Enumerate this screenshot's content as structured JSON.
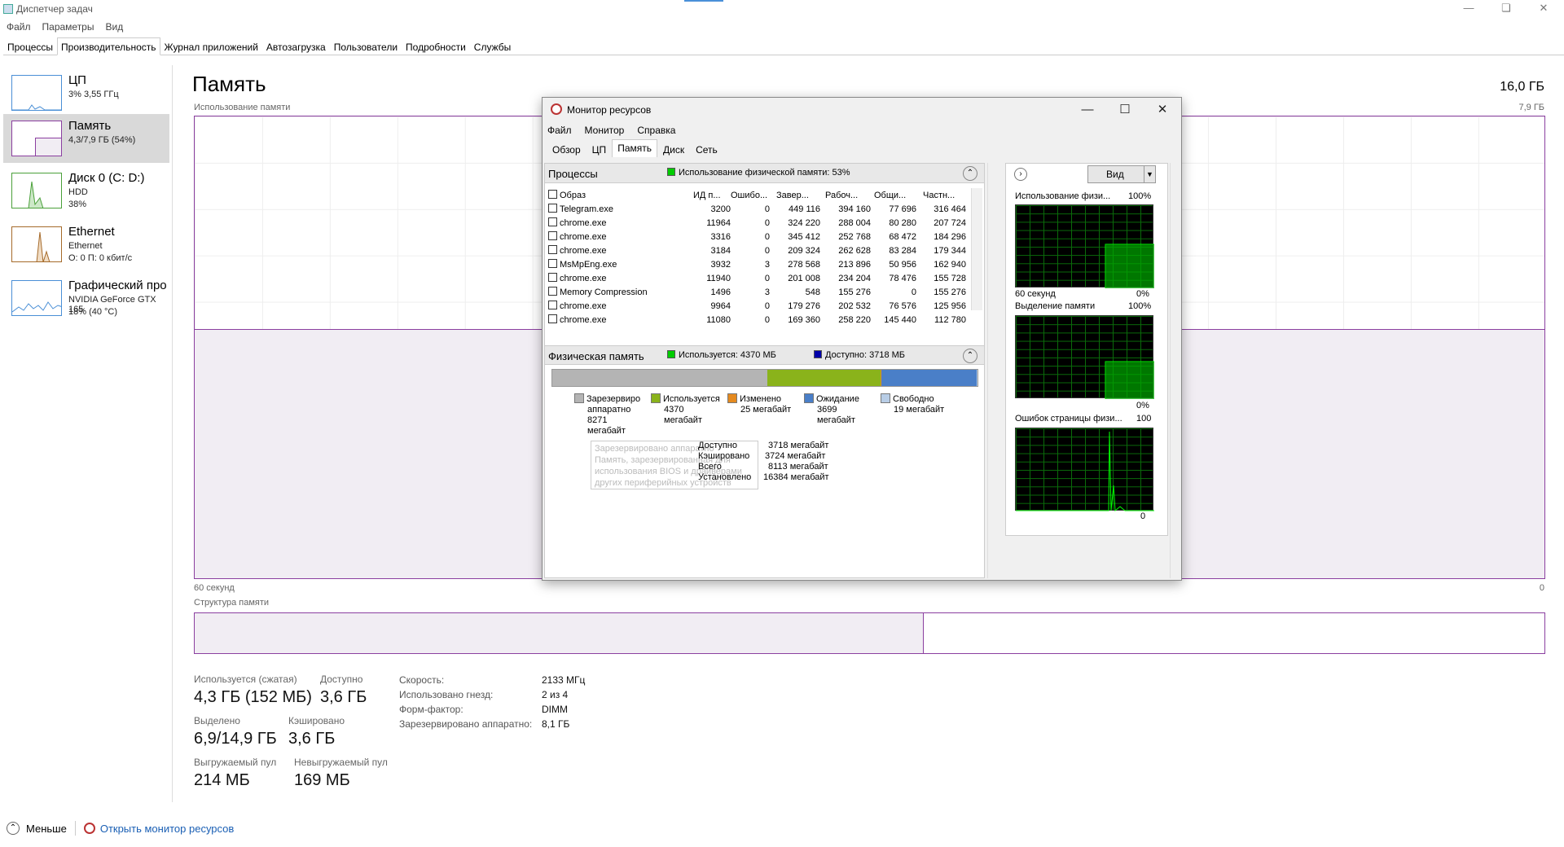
{
  "window": {
    "title": "Диспетчер задач"
  },
  "menu": [
    "Файл",
    "Параметры",
    "Вид"
  ],
  "tabs": [
    "Процессы",
    "Производительность",
    "Журнал приложений",
    "Автозагрузка",
    "Пользователи",
    "Подробности",
    "Службы"
  ],
  "sidebar": [
    {
      "name": "ЦП",
      "l2": "3% 3,55 ГГц",
      "l3": ""
    },
    {
      "name": "Память",
      "l2": "4,3/7,9 ГБ (54%)",
      "l3": ""
    },
    {
      "name": "Диск 0 (C: D:)",
      "l2": "HDD",
      "l3": "38%"
    },
    {
      "name": "Ethernet",
      "l2": "Ethernet",
      "l3": "О: 0 П: 0 кбит/с"
    },
    {
      "name": "Графический про",
      "l2": "NVIDIA GeForce GTX 165",
      "l3": "18% (40 °C)"
    }
  ],
  "main": {
    "title": "Память",
    "total": "16,0 ГБ",
    "usage_label": "Использование памяти",
    "usage_max": "7,9 ГБ",
    "time_label": "60 секунд",
    "time_zero": "0",
    "struct_label": "Структура памяти",
    "graph_fill_fraction": 0.54
  },
  "stats": [
    {
      "label": "Используется (сжатая)",
      "value": "4,3 ГБ (152 МБ)"
    },
    {
      "label": "Доступно",
      "value": "3,6 ГБ"
    },
    {
      "label": "Выделено",
      "value": "6,9/14,9 ГБ"
    },
    {
      "label": "Кэшировано",
      "value": "3,6 ГБ"
    },
    {
      "label": "Выгружаемый пул",
      "value": "214 МБ"
    },
    {
      "label": "Невыгружаемый пул",
      "value": "169 МБ"
    }
  ],
  "kv": [
    {
      "k": "Скорость:",
      "v": "2133 МГц"
    },
    {
      "k": "Использовано гнезд:",
      "v": "2 из 4"
    },
    {
      "k": "Форм-фактор:",
      "v": "DIMM"
    },
    {
      "k": "Зарезервировано аппаратно:",
      "v": "8,1 ГБ"
    }
  ],
  "bottom": {
    "less": "Меньше",
    "open_rm": "Открыть монитор ресурсов"
  },
  "rm": {
    "title": "Монитор ресурсов",
    "menu": [
      "Файл",
      "Монитор",
      "Справка"
    ],
    "tabs": [
      "Обзор",
      "ЦП",
      "Память",
      "Диск",
      "Сеть"
    ],
    "processes": {
      "title": "Процессы",
      "usage": "Использование физической памяти: 53%",
      "columns": [
        "Образ",
        "ИД п...",
        "Ошибо...",
        "Завер...",
        "Рабоч...",
        "Общи...",
        "Частн..."
      ],
      "rows": [
        [
          "Telegram.exe",
          "3200",
          "0",
          "449 116",
          "394 160",
          "77 696",
          "316 464"
        ],
        [
          "chrome.exe",
          "11964",
          "0",
          "324 220",
          "288 004",
          "80 280",
          "207 724"
        ],
        [
          "chrome.exe",
          "3316",
          "0",
          "345 412",
          "252 768",
          "68 472",
          "184 296"
        ],
        [
          "chrome.exe",
          "3184",
          "0",
          "209 324",
          "262 628",
          "83 284",
          "179 344"
        ],
        [
          "MsMpEng.exe",
          "3932",
          "3",
          "278 568",
          "213 896",
          "50 956",
          "162 940"
        ],
        [
          "chrome.exe",
          "11940",
          "0",
          "201 008",
          "234 204",
          "78 476",
          "155 728"
        ],
        [
          "Memory Compression",
          "1496",
          "3",
          "548",
          "155 276",
          "0",
          "155 276"
        ],
        [
          "chrome.exe",
          "9964",
          "0",
          "179 276",
          "202 532",
          "76 576",
          "125 956"
        ],
        [
          "chrome.exe",
          "11080",
          "0",
          "169 360",
          "258 220",
          "145 440",
          "112 780"
        ]
      ]
    },
    "physical": {
      "title": "Физическая память",
      "used": "Используется: 4370 МБ",
      "avail": "Доступно: 3718 МБ",
      "legend": [
        {
          "name": "Зарезервиро",
          "l2": "аппаратно",
          "l3": "8271",
          "l4": "мегабайт",
          "color": "#b4b4b4"
        },
        {
          "name": "Используется",
          "l2": "4370",
          "l3": "мегабайт",
          "l4": "",
          "color": "#8ab31b"
        },
        {
          "name": "Изменено",
          "l2": "25 мегабайт",
          "l3": "",
          "l4": "",
          "color": "#e58a1f"
        },
        {
          "name": "Ожидание",
          "l2": "3699",
          "l3": "мегабайт",
          "l4": "",
          "color": "#4a7fc8"
        },
        {
          "name": "Свободно",
          "l2": "19 мегабайт",
          "l3": "",
          "l4": "",
          "color": "#b8cde6"
        }
      ],
      "summary": [
        {
          "k": "Доступно",
          "v": "3718 мегабайт"
        },
        {
          "k": "Кэшировано",
          "v": "3724 мегабайт"
        },
        {
          "k": "Всего",
          "v": "8113 мегабайт"
        },
        {
          "k": "Установлено",
          "v": "16384 мегабайт"
        }
      ],
      "tooltip": [
        "Зарезервировано аппаратно",
        "Память, зарезервированная для",
        "использования BIOS и драйверами",
        "других периферийных устройств"
      ]
    },
    "right": {
      "view": "Вид",
      "g1": {
        "title": "Использование физи...",
        "max": "100%",
        "time": "60 секунд",
        "min": "0%"
      },
      "g2": {
        "title": "Выделение памяти",
        "max": "100%",
        "min": "0%"
      },
      "g3": {
        "title": "Ошибок страницы физи...",
        "max": "100",
        "min": "0"
      }
    }
  }
}
